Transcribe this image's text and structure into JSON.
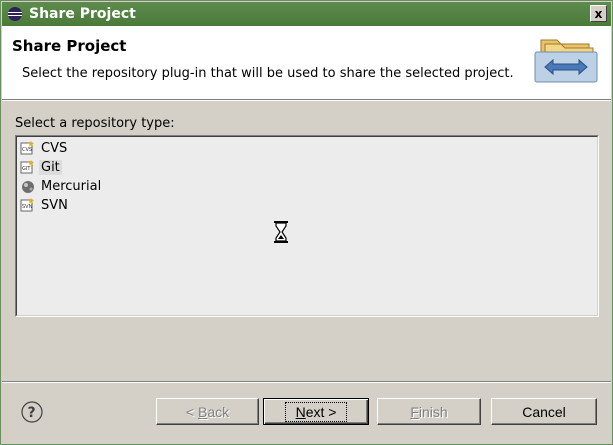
{
  "window": {
    "title": "Share Project",
    "close_label": "x"
  },
  "header": {
    "title": "Share Project",
    "description": "Select the repository plug-in that will be used to share the selected project."
  },
  "repository": {
    "label": "Select a repository type:",
    "items": [
      {
        "label": "CVS",
        "icon": "cvs-icon",
        "selected": false
      },
      {
        "label": "Git",
        "icon": "git-icon",
        "selected": true
      },
      {
        "label": "Mercurial",
        "icon": "mercurial-icon",
        "selected": false
      },
      {
        "label": "SVN",
        "icon": "svn-icon",
        "selected": false
      }
    ]
  },
  "buttons": {
    "back": {
      "label_prefix": "< ",
      "label_mnemonic": "B",
      "label_rest": "ack",
      "enabled": false
    },
    "next": {
      "label_mnemonic": "N",
      "label_rest": "ext >",
      "enabled": true
    },
    "finish": {
      "label_mnemonic": "F",
      "label_rest": "inish",
      "enabled": false
    },
    "cancel": {
      "label": "Cancel",
      "enabled": true
    }
  },
  "colors": {
    "titlebar": "#5f8a4e",
    "dialog_bg": "#d4d0c8",
    "header_bg": "#ffffff"
  }
}
